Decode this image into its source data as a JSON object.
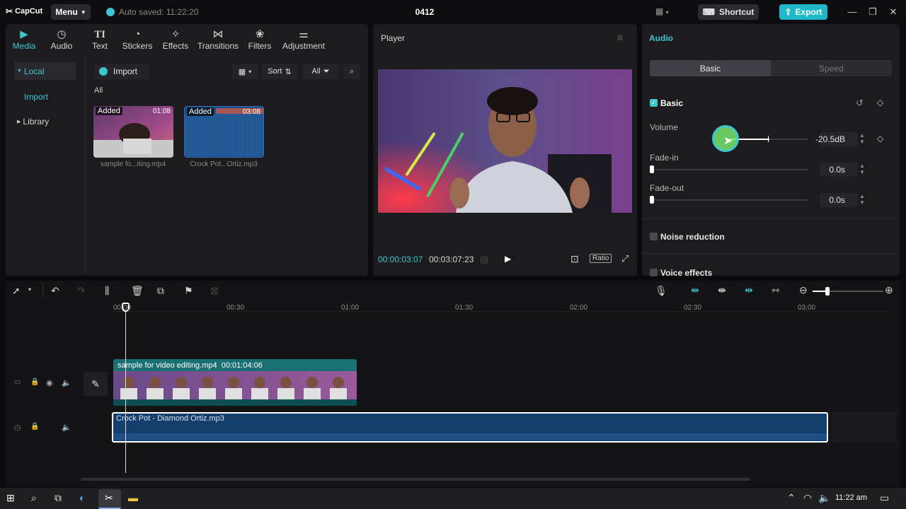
{
  "app": {
    "logo": "CapCut",
    "menu_label": "Menu",
    "autosave": "Auto saved: 11:22:20",
    "project_title": "0412",
    "shortcut_label": "Shortcut",
    "export_label": "Export"
  },
  "media_tabs": [
    {
      "label": "Media",
      "icon": "media-icon",
      "active": true
    },
    {
      "label": "Audio",
      "icon": "audio-icon"
    },
    {
      "label": "Text",
      "icon": "text-icon"
    },
    {
      "label": "Stickers",
      "icon": "sticker-icon"
    },
    {
      "label": "Effects",
      "icon": "effects-icon"
    },
    {
      "label": "Transitions",
      "icon": "transitions-icon"
    },
    {
      "label": "Filters",
      "icon": "filters-icon"
    },
    {
      "label": "Adjustment",
      "icon": "adjustment-icon"
    }
  ],
  "sidebar": {
    "local": "Local",
    "import": "Import",
    "library": "Library"
  },
  "media": {
    "import_label": "Import",
    "sort_label": "Sort",
    "all_filter": "All",
    "section_label": "All",
    "items": [
      {
        "tag": "Added",
        "duration": "01:08",
        "name": "sample fo...iting.mp4"
      },
      {
        "tag": "Added",
        "duration": "03:08",
        "name": "Crock Pot...Ortiz.mp3"
      }
    ]
  },
  "player": {
    "title": "Player",
    "current_time": "00:00:03:07",
    "total_time": "00:03:07:23",
    "ratio_label": "Ratio"
  },
  "audio_panel": {
    "title": "Audio",
    "tabs": [
      "Basic",
      "Speed"
    ],
    "basic_label": "Basic",
    "volume_label": "Volume",
    "volume_value": "-20.5dB",
    "fade_in_label": "Fade-in",
    "fade_in_value": "0.0s",
    "fade_out_label": "Fade-out",
    "fade_out_value": "0.0s",
    "noise_label": "Noise reduction",
    "voice_label": "Voice effects"
  },
  "timeline": {
    "ruler": [
      "00:00",
      "00:30",
      "01:00",
      "01:30",
      "02:00",
      "02:30",
      "03:00"
    ],
    "video_clip": {
      "name": "sample for video editing.mp4",
      "duration": "00:01:04:06"
    },
    "audio_clip": {
      "name": "Crock Pot - Diamond Ortiz.mp3"
    }
  },
  "taskbar": {
    "time": "11:22 am"
  },
  "colors": {
    "accent": "#3ec6d0",
    "export": "#1fb8c9",
    "video_clip": "#1a6f72",
    "audio_clip": "#143e6b"
  }
}
